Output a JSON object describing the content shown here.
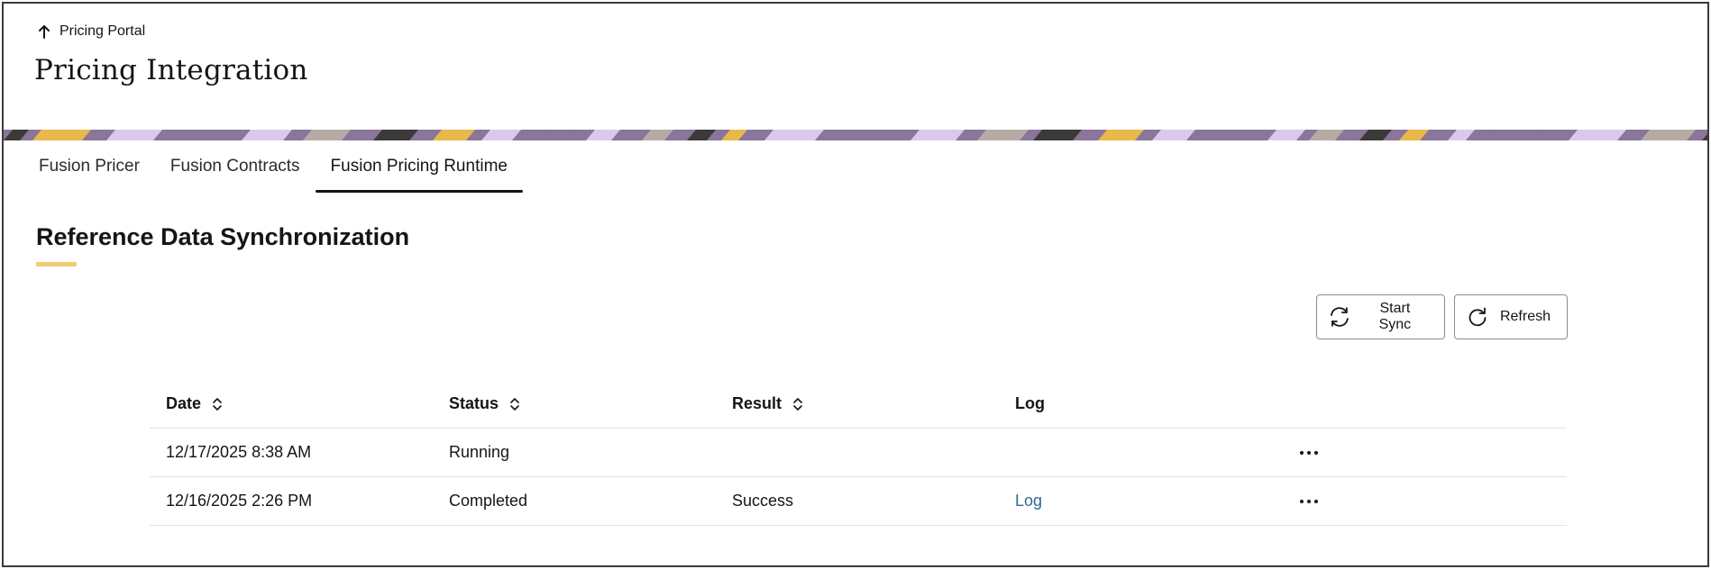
{
  "header": {
    "back_label": "Pricing Portal",
    "title": "Pricing Integration"
  },
  "tabs": [
    {
      "label": "Fusion Pricer",
      "active": false
    },
    {
      "label": "Fusion Contracts",
      "active": false
    },
    {
      "label": "Fusion Pricing Runtime",
      "active": true
    }
  ],
  "section": {
    "title": "Reference Data Synchronization",
    "accent_color": "#f0cc71"
  },
  "toolbar": {
    "start_sync_label": "Start Sync",
    "start_sync_icon": "sync-icon",
    "refresh_label": "Refresh",
    "refresh_icon": "refresh-icon"
  },
  "table": {
    "columns": [
      {
        "label": "Date",
        "sortable": true
      },
      {
        "label": "Status",
        "sortable": true
      },
      {
        "label": "Result",
        "sortable": true
      },
      {
        "label": "Log",
        "sortable": false
      }
    ],
    "rows": [
      {
        "date": "12/17/2025 8:38 AM",
        "status": "Running",
        "result": "",
        "log": ""
      },
      {
        "date": "12/16/2025 2:26 PM",
        "status": "Completed",
        "result": "Success",
        "log": "Log"
      }
    ],
    "row_action_icon": "more-horizontal-icon"
  },
  "colors": {
    "link": "#2e6a8e",
    "banner_purple": "#8a759b",
    "banner_lilac": "#dcc8ee",
    "banner_gold": "#e8b84a",
    "banner_dark": "#3b3a38",
    "banner_grey": "#b4aca4"
  }
}
